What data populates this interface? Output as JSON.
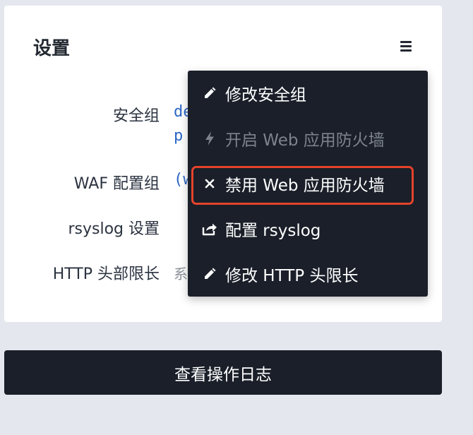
{
  "settings": {
    "title": "设置",
    "rows": [
      {
        "label": "安全组",
        "value_line1": "de",
        "value_line2": "p"
      },
      {
        "label": "WAF 配置组",
        "value": "(w"
      },
      {
        "label": "rsyslog 设置",
        "value": ""
      },
      {
        "label": "HTTP 头部限长",
        "value": "系"
      }
    ]
  },
  "dropdown": {
    "items": [
      {
        "label": "修改安全组",
        "icon": "pencil-icon",
        "disabled": false
      },
      {
        "label": "开启 Web 应用防火墙",
        "icon": "lightning-icon",
        "disabled": true
      },
      {
        "label": "禁用 Web 应用防火墙",
        "icon": "close-icon",
        "disabled": false,
        "highlighted": true
      },
      {
        "label": "配置 rsyslog",
        "icon": "share-icon",
        "disabled": false
      },
      {
        "label": "修改 HTTP 头限长",
        "icon": "pencil-icon",
        "disabled": false
      }
    ]
  },
  "footer": {
    "view_log_label": "查看操作日志"
  },
  "colors": {
    "background": "#e4e8ee",
    "card": "#ffffff",
    "menu_bg": "#1a1f29",
    "link": "#2b66c4",
    "highlight": "#e5432b",
    "disabled_text": "#7d838d"
  }
}
